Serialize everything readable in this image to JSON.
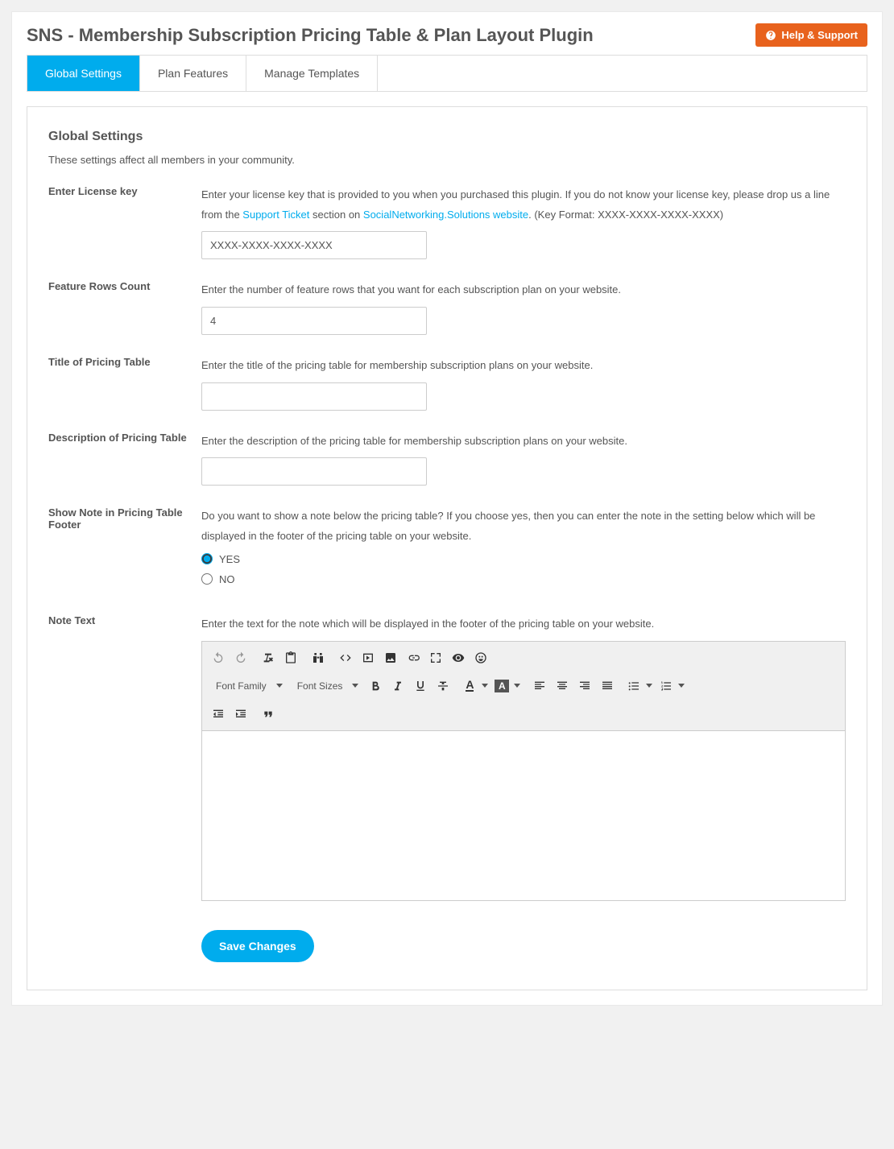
{
  "header": {
    "title": "SNS - Membership Subscription Pricing Table & Plan Layout Plugin",
    "help_label": "Help & Support"
  },
  "tabs": [
    {
      "label": "Global Settings",
      "active": true
    },
    {
      "label": "Plan Features",
      "active": false
    },
    {
      "label": "Manage Templates",
      "active": false
    }
  ],
  "panel": {
    "title": "Global Settings",
    "subtitle": "These settings affect all members in your community."
  },
  "fields": {
    "license": {
      "label": "Enter License key",
      "desc_pre": "Enter your license key that is provided to you when you purchased this plugin. If you do not know your license key, please drop us a line from the ",
      "link1": "Support Ticket",
      "desc_mid": " section on ",
      "link2": "SocialNetworking.Solutions website",
      "desc_post": ". (Key Format: XXXX-XXXX-XXXX-XXXX)",
      "value": "XXXX-XXXX-XXXX-XXXX"
    },
    "rows": {
      "label": "Feature Rows Count",
      "desc": "Enter the number of feature rows that you want for each subscription plan on your website.",
      "value": "4"
    },
    "title": {
      "label": "Title of Pricing Table",
      "desc": "Enter the title of the pricing table for membership subscription plans on your website.",
      "value": ""
    },
    "description": {
      "label": "Description of Pricing Table",
      "desc": "Enter the description of the pricing table for membership subscription plans on your website.",
      "value": ""
    },
    "show_note": {
      "label": "Show Note in Pricing Table Footer",
      "desc": "Do you want to show a note below the pricing table? If you choose yes, then you can enter the note in the setting below which will be displayed in the footer of the pricing table on your website.",
      "option_yes": "YES",
      "option_no": "NO",
      "selected": "YES"
    },
    "note_text": {
      "label": "Note Text",
      "desc": "Enter the text for the note which will be displayed in the footer of the pricing table on your website."
    }
  },
  "editor": {
    "font_family": "Font Family",
    "font_sizes": "Font Sizes"
  },
  "actions": {
    "save": "Save Changes"
  }
}
